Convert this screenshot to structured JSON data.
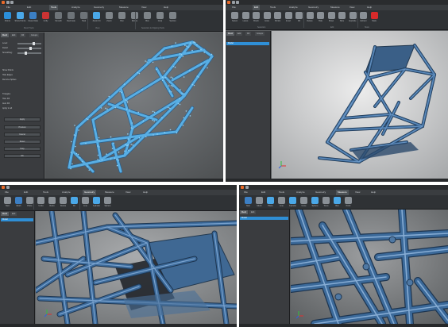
{
  "q1": {
    "menu": [
      "File",
      "Edit",
      "Tools",
      "Analyze",
      "Geometry",
      "Measure",
      "View",
      "Help"
    ],
    "active_menu": "Tools",
    "ribbon_buttons": [
      "Points",
      "Show Points",
      "Clean Data",
      "Unify",
      "Smooth",
      "Decimate",
      "Heal",
      "Zoom Fit",
      "Zoom",
      "Pan",
      "Rotate",
      "Box",
      "Crop",
      "Section"
    ],
    "group_captions": [
      "Mesh Tools",
      "View",
      "Selection & Clipping Tools"
    ],
    "panel_tabs": [
      "Mesh",
      "Edit",
      "Fill",
      "Groups"
    ],
    "panel_rows": [
      "Level:",
      "Detail:",
      "Smoothing:",
      "Show Points",
      "Hide Edges",
      "Remove Spikes",
      "Triangles",
      "Hole Fill",
      "Auto Fill",
      "Apply to all"
    ],
    "panel_buttons": [
      "Apply",
      "Preview",
      "Cancel",
      "Reset",
      "Help",
      "OK"
    ]
  },
  "q2": {
    "menu": [
      "File",
      "Edit",
      "Tools",
      "Analyze",
      "Geometry",
      "Measure",
      "View",
      "Help"
    ],
    "active_menu": "Edit",
    "ribbon_buttons": [
      "Select",
      "Lasso",
      "Brush",
      "Grow",
      "Shrink",
      "Invert",
      "Fill",
      "Delete",
      "Hide",
      "Show",
      "Slice",
      "Explode",
      "Extract",
      "Stats"
    ],
    "group_captions": [
      "Selection",
      "Edit",
      "Stats"
    ],
    "panel_tabs": [
      "Mesh",
      "Edit",
      "Fill",
      "Groups"
    ],
    "tree_item": "Model"
  },
  "q3": {
    "menu": [
      "File",
      "Edit",
      "Tools",
      "Analyze",
      "Geometry",
      "Measure",
      "View",
      "Help"
    ],
    "active_menu": "Geometry",
    "ribbon_buttons": [
      "New",
      "Mesh",
      "Plane",
      "Undo",
      "Redo",
      "Delete",
      "Fit",
      "Line",
      "Cylinder",
      "Sphere"
    ],
    "panel_tabs": [
      "Mesh",
      "Edit"
    ],
    "tree_item": "Model"
  },
  "q4": {
    "menu": [
      "File",
      "Edit",
      "Tools",
      "Analyze",
      "Geometry",
      "Measure",
      "View",
      "Help"
    ],
    "active_menu": "Measure",
    "ribbon_buttons": [
      "New",
      "Mesh",
      "Plane",
      "Line",
      "Cylinder",
      "Cone",
      "Sphere",
      "Torus",
      "Box",
      "Point"
    ],
    "panel_tabs": [
      "Mesh",
      "Edit"
    ],
    "tree_item": "Model"
  },
  "colors": {
    "chrome_dark": "#2f3235",
    "viewport_gray": "#5d6062",
    "scan_blue": "#58aee4",
    "mesh_blue": "#3c6a9a",
    "selection_blue": "#2f8fd6",
    "accent_red": "#d62a2a",
    "corner_accent": "#3ed3a6"
  }
}
